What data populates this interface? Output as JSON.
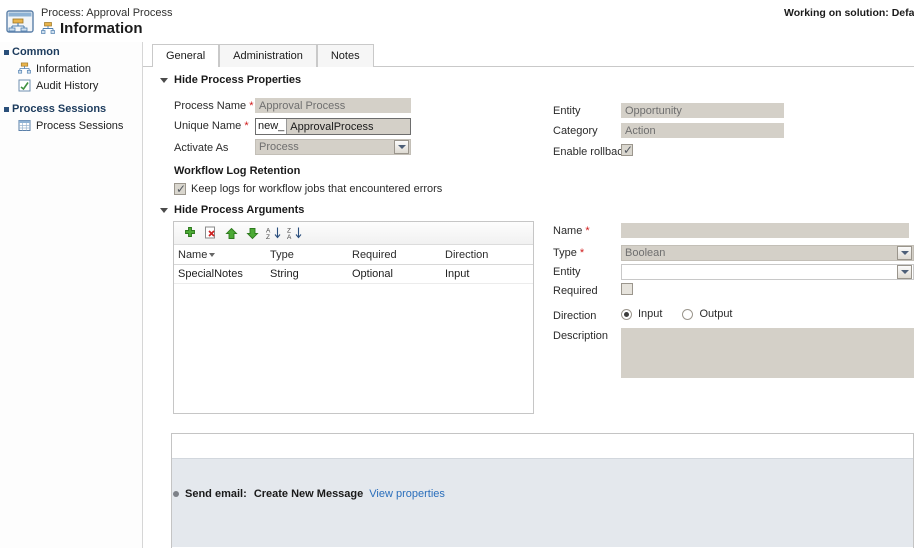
{
  "header": {
    "breadcrumb": "Process: Approval Process",
    "title": "Information",
    "solution_text": "Working on solution: Default So",
    "process_icon": "process-window-icon",
    "title_icon": "process-node-icon"
  },
  "sidebar": {
    "groups": [
      {
        "label": "Common",
        "items": [
          {
            "label": "Information",
            "icon": "process-node-icon"
          },
          {
            "label": "Audit History",
            "icon": "audit-history-icon"
          }
        ]
      },
      {
        "label": "Process Sessions",
        "items": [
          {
            "label": "Process Sessions",
            "icon": "grid-icon"
          }
        ]
      }
    ]
  },
  "tabs": [
    {
      "label": "General",
      "active": true
    },
    {
      "label": "Administration",
      "active": false
    },
    {
      "label": "Notes",
      "active": false
    }
  ],
  "process_properties": {
    "section_label": "Hide Process Properties",
    "process_name": {
      "label": "Process Name",
      "required": true,
      "value": "Approval Process"
    },
    "unique_name": {
      "label": "Unique Name",
      "required": true,
      "prefix": "new_",
      "value": "ApprovalProcess"
    },
    "activate_as": {
      "label": "Activate As",
      "required": false,
      "value": "Process"
    },
    "entity": {
      "label": "Entity",
      "required": false,
      "value": "Opportunity"
    },
    "category": {
      "label": "Category",
      "required": false,
      "value": "Action"
    },
    "enable_rollback": {
      "label": "Enable rollback",
      "checked": true
    },
    "workflow_log_retention": {
      "heading": "Workflow Log Retention",
      "checkbox_label": "Keep logs for workflow jobs that encountered errors",
      "checked": true
    }
  },
  "process_arguments": {
    "section_label": "Hide Process Arguments",
    "toolbar": [
      {
        "name": "add-argument-button",
        "icon": "plus-icon"
      },
      {
        "name": "delete-argument-button",
        "icon": "delete-document-icon"
      },
      {
        "name": "move-up-button",
        "icon": "arrow-up-icon"
      },
      {
        "name": "move-down-button",
        "icon": "arrow-down-icon"
      },
      {
        "name": "sort-ascending-button",
        "icon": "sort-az-icon"
      },
      {
        "name": "sort-descending-button",
        "icon": "sort-za-icon"
      }
    ],
    "columns": [
      "Name",
      "Type",
      "Required",
      "Direction"
    ],
    "rows": [
      {
        "name": "SpecialNotes",
        "type": "String",
        "required": "Optional",
        "direction": "Input"
      }
    ],
    "detail": {
      "name": {
        "label": "Name",
        "required": true,
        "value": ""
      },
      "type": {
        "label": "Type",
        "required": true,
        "value": "Boolean"
      },
      "entity": {
        "label": "Entity",
        "required": false,
        "value": ""
      },
      "required": {
        "label": "Required",
        "checked": false
      },
      "direction": {
        "label": "Direction",
        "options": [
          {
            "label": "Input",
            "selected": true
          },
          {
            "label": "Output",
            "selected": false
          }
        ]
      },
      "description": {
        "label": "Description",
        "value": ""
      }
    }
  },
  "steps": [
    {
      "prefix": "Send email:",
      "name": "Create New Message",
      "link": "View properties"
    }
  ],
  "colors": {
    "accent_link": "#2a6ebb",
    "required_asterisk": "#d01a1a",
    "disabled_field": "#d4d0c8",
    "step_row": "#e4e8ed",
    "nav_group": "#1b3a5c"
  }
}
